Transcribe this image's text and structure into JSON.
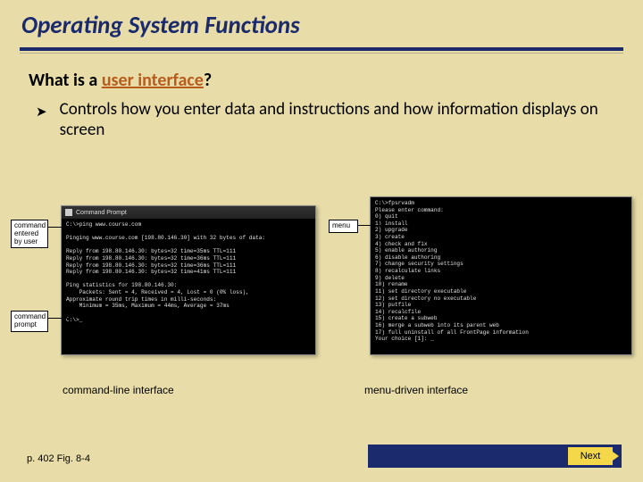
{
  "title": "Operating System Functions",
  "question_prefix": "What is a ",
  "question_keyword": "user interface",
  "question_suffix": "?",
  "bullet": "Controls how you enter data and instructions and how information displays on screen",
  "callouts": {
    "cmd_entered": "command entered by user",
    "cmd_prompt": "command prompt",
    "menu": "menu"
  },
  "cli": {
    "titlebar": "Command Prompt",
    "text": "C:\\>ping www.course.com\n\nPinging www.course.com [198.80.146.30] with 32 bytes of data:\n\nReply from 198.80.146.30: bytes=32 time=35ms TTL=111\nReply from 198.80.146.30: bytes=32 time=36ms TTL=111\nReply from 198.80.146.30: bytes=32 time=36ms TTL=111\nReply from 198.80.146.30: bytes=32 time=41ms TTL=111\n\nPing statistics for 198.80.146.30:\n    Packets: Sent = 4, Received = 4, Lost = 0 (0% loss),\nApproximate round trip times in milli-seconds:\n    Minimum = 35ms, Maximum = 44ms, Average = 37ms\n\nC:\\>_"
  },
  "menu_screen": {
    "text": "C:\\>fpsrvadm\nPlease enter command:\n0) quit\n1) install\n2) upgrade\n3) create\n4) check and fix\n5) enable authoring\n6) disable authoring\n7) change security settings\n8) recalculate links\n9) delete\n10) rename\n11) set directory executable\n12) set directory no executable\n13) putfile\n14) recalcfile\n15) create a subweb\n16) merge a subweb into its parent web\n17) full uninstall of all FrontPage information\nYour choice [1]: _"
  },
  "captions": {
    "left": "command-line interface",
    "right": "menu-driven interface"
  },
  "footer": {
    "page_ref": "p. 402 Fig. 8-4",
    "next": "Next"
  }
}
